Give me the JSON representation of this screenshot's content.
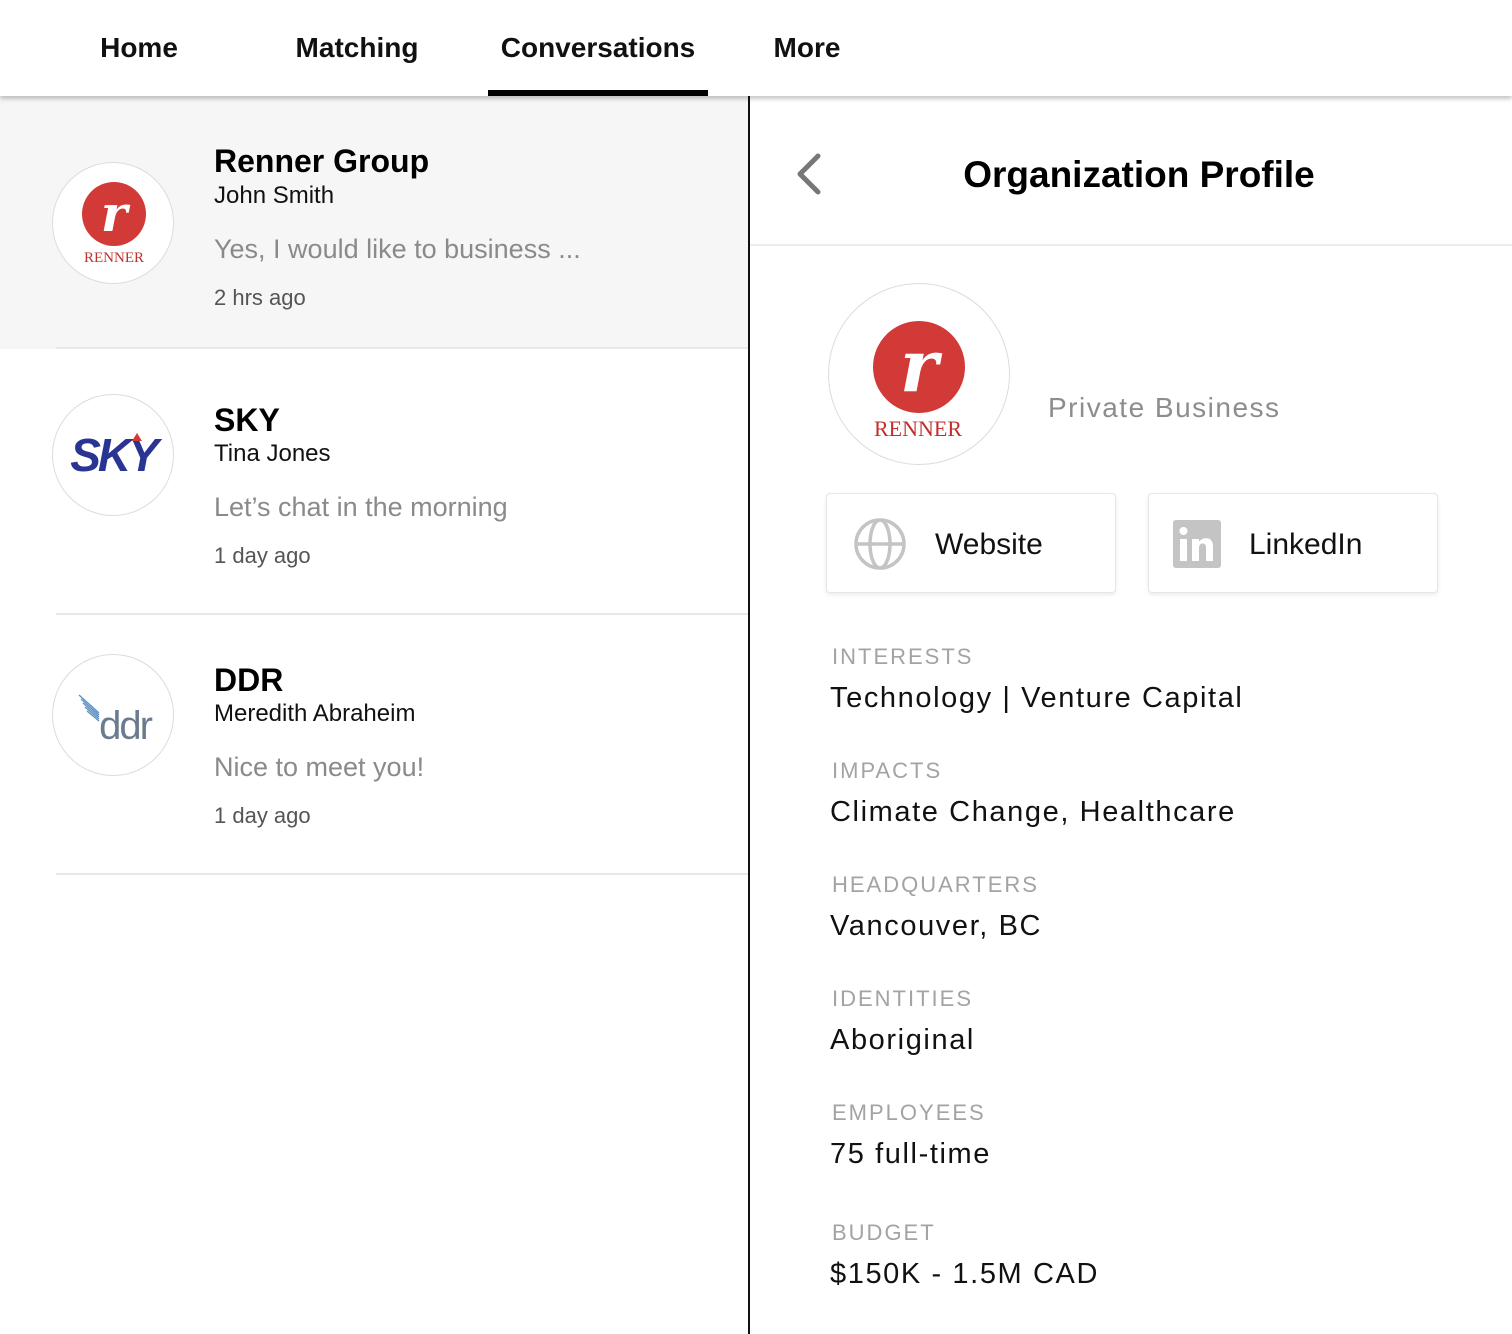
{
  "nav": {
    "tabs": [
      {
        "label": "Home"
      },
      {
        "label": "Matching"
      },
      {
        "label": "Conversations"
      },
      {
        "label": "More"
      }
    ],
    "active_tab": "Conversations"
  },
  "conversations": [
    {
      "org": "Renner Group",
      "person": "John Smith",
      "message": "Yes, I would like to business ...",
      "time": "2 hrs ago",
      "selected": true,
      "logo_text": "RENNER"
    },
    {
      "org": "SKY",
      "person": "Tina Jones",
      "message": "Let’s chat in the morning",
      "time": "1 day ago",
      "selected": false,
      "logo_text": "SKY"
    },
    {
      "org": "DDR",
      "person": "Meredith Abraheim",
      "message": "Nice to meet you!",
      "time": "1 day ago",
      "selected": false,
      "logo_text": "ddr"
    }
  ],
  "profile": {
    "title": "Organization Profile",
    "logo_text": "RENNER",
    "org_type": "Private Business",
    "links": {
      "website": "Website",
      "linkedin": "LinkedIn"
    },
    "fields": [
      {
        "label": "INTERESTS",
        "value": "Technology | Venture Capital"
      },
      {
        "label": "IMPACTS",
        "value": "Climate Change, Healthcare"
      },
      {
        "label": "HEADQUARTERS",
        "value": "Vancouver, BC"
      },
      {
        "label": "IDENTITIES",
        "value": "Aboriginal"
      },
      {
        "label": "EMPLOYEES",
        "value": "75 full-time"
      },
      {
        "label": "BUDGET",
        "value": "$150K - 1.5M CAD"
      }
    ]
  },
  "colors": {
    "renner_red": "#d13a36",
    "sky_blue": "#2a3593",
    "ddr_blue": "#5b8fc2",
    "icon_gray": "#c4c4c4"
  },
  "icons": [
    "chevron-left-icon",
    "globe-icon",
    "linkedin-icon"
  ]
}
